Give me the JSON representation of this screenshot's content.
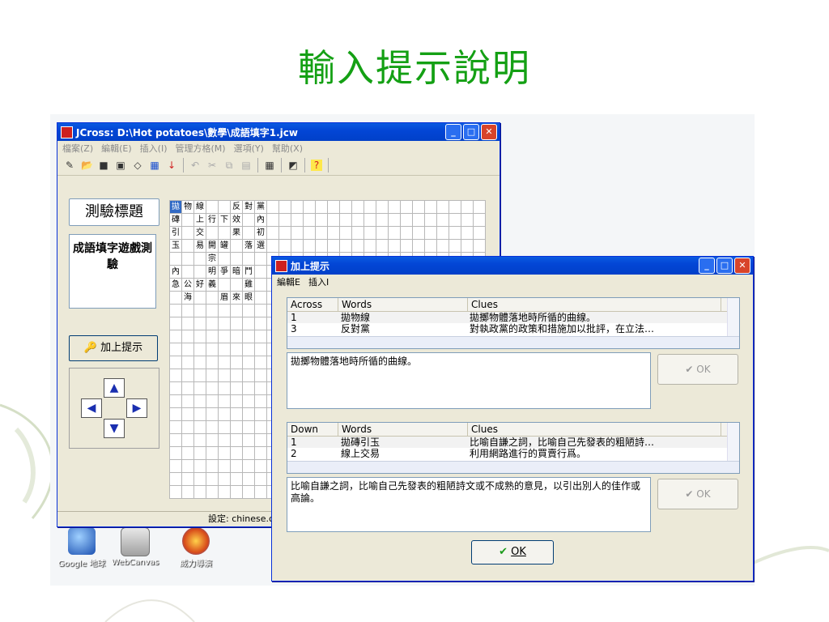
{
  "slide": {
    "title": "輸入提示說明"
  },
  "main_window": {
    "title": "JCross: D:\\Hot potatoes\\數學\\成語填字1.jcw",
    "menu": [
      "檔案(Z)",
      "編輯(E)",
      "插入(I)",
      "管理方格(M)",
      "選項(Y)",
      "幫助(X)"
    ],
    "quiz_title_label": "測驗標題",
    "quiz_title_value": "成語填字遊戲測驗",
    "add_clue_label": "加上提示",
    "status_text": "設定: chinese.cf",
    "grid_rows": [
      [
        "拋",
        "物",
        "線",
        "",
        "",
        "反",
        "對",
        "黨"
      ],
      [
        "磚",
        "",
        "上",
        "行",
        "下",
        "效",
        "",
        "內"
      ],
      [
        "引",
        "",
        "交",
        "",
        "",
        "果",
        "",
        "初"
      ],
      [
        "玉",
        "",
        "易",
        "開",
        "罐",
        "",
        "落",
        "選"
      ],
      [
        "",
        "",
        "",
        "宗",
        "",
        "",
        "",
        ""
      ],
      [
        "內",
        "",
        "",
        "明",
        "爭",
        "暗",
        "鬥",
        ""
      ],
      [
        "急",
        "公",
        "好",
        "義",
        "",
        "",
        "雞",
        ""
      ],
      [
        "",
        "海",
        "",
        "",
        "眉",
        "來",
        "眼",
        ""
      ]
    ]
  },
  "dialog": {
    "title": "加上提示",
    "menu": [
      "編輯E",
      "插入I"
    ],
    "across": {
      "headers": [
        "Across",
        "Words",
        "Clues"
      ],
      "rows": [
        [
          "1",
          "拋物線",
          "拋擲物體落地時所循的曲線。"
        ],
        [
          "3",
          "反對黨",
          "對執政黨的政策和措施加以批評，在立法…"
        ]
      ],
      "edit_text": "拋擲物體落地時所循的曲線。",
      "ok_label": "OK"
    },
    "down": {
      "headers": [
        "Down",
        "Words",
        "Clues"
      ],
      "rows": [
        [
          "1",
          "拋磚引玉",
          "比喻自謙之詞，比喻自己先發表的粗陋詩…"
        ],
        [
          "2",
          "線上交易",
          "利用網路進行的買賣行爲。"
        ]
      ],
      "edit_text": "比喻自謙之詞，比喻自己先發表的粗陋詩文或不成熟的意見，以引出別人的佳作或高論。",
      "ok_label": "OK"
    },
    "ok_label": "OK"
  },
  "desktop_icons": [
    "Google 地球",
    "WebCanvas",
    "威力導演"
  ]
}
